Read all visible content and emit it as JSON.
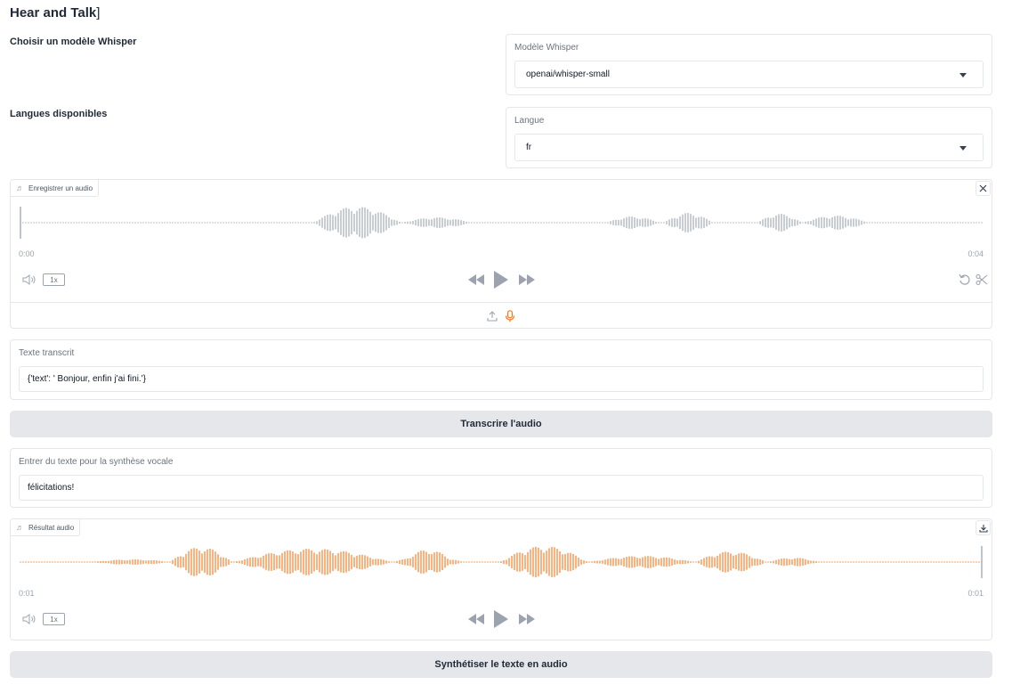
{
  "app": {
    "title": "Hear and Talk",
    "title_suffix": "]"
  },
  "model_section": {
    "heading": "Choisir un modèle Whisper",
    "label": "Modèle Whisper",
    "value": "openai/whisper-small"
  },
  "lang_section": {
    "heading": "Langues disponibles",
    "label": "Langue",
    "value": "fr"
  },
  "recorder": {
    "chip_label": "Enregistrer un audio",
    "time_start": "0:00",
    "time_end": "0:04",
    "rate": "1x",
    "wave_color": "#9ca3af",
    "icons": [
      "music-note-icon",
      "close-icon",
      "volume-icon",
      "rewind-icon",
      "play-icon",
      "fast-forward-icon",
      "undo-icon",
      "scissors-icon",
      "upload-icon",
      "microphone-icon"
    ]
  },
  "transcript": {
    "label": "Texte transcrit",
    "value": "{'text': ' Bonjour, enfin j'ai fini.'}"
  },
  "transcribe_button": "Transcrire l'audio",
  "tts_input": {
    "label": "Entrer du texte pour la synthèse vocale",
    "value": "félicitations!"
  },
  "result_audio": {
    "chip_label": "Résultat audio",
    "time_start": "0:01",
    "time_end": "0:01",
    "rate": "1x",
    "wave_color": "#f97316",
    "icons": [
      "music-note-icon",
      "download-icon",
      "volume-icon",
      "rewind-icon",
      "play-icon",
      "fast-forward-icon"
    ]
  },
  "synthesize_button": "Synthétiser le texte en audio",
  "colors": {
    "accent": "#f97316",
    "muted": "#9ca3af",
    "button_bg": "#e5e7eb"
  }
}
